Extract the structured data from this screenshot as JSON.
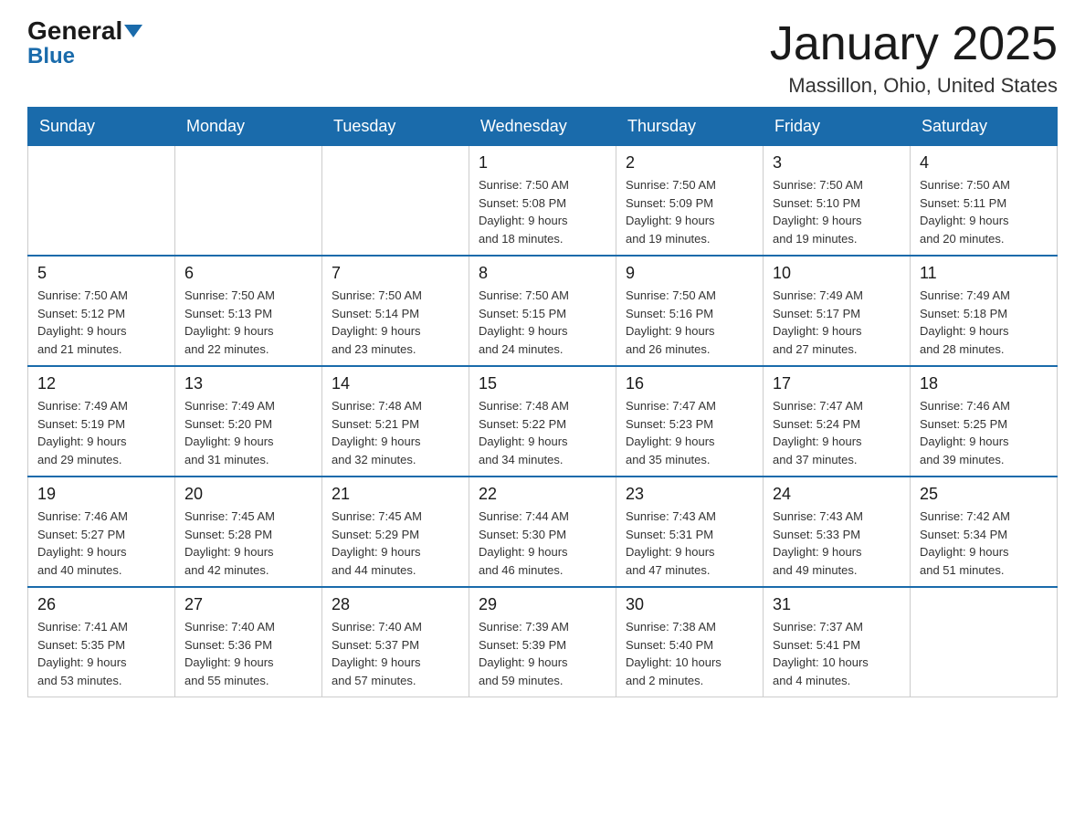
{
  "logo": {
    "general": "General",
    "blue": "Blue"
  },
  "header": {
    "title": "January 2025",
    "location": "Massillon, Ohio, United States"
  },
  "days_of_week": [
    "Sunday",
    "Monday",
    "Tuesday",
    "Wednesday",
    "Thursday",
    "Friday",
    "Saturday"
  ],
  "weeks": [
    [
      {
        "day": "",
        "info": ""
      },
      {
        "day": "",
        "info": ""
      },
      {
        "day": "",
        "info": ""
      },
      {
        "day": "1",
        "info": "Sunrise: 7:50 AM\nSunset: 5:08 PM\nDaylight: 9 hours\nand 18 minutes."
      },
      {
        "day": "2",
        "info": "Sunrise: 7:50 AM\nSunset: 5:09 PM\nDaylight: 9 hours\nand 19 minutes."
      },
      {
        "day": "3",
        "info": "Sunrise: 7:50 AM\nSunset: 5:10 PM\nDaylight: 9 hours\nand 19 minutes."
      },
      {
        "day": "4",
        "info": "Sunrise: 7:50 AM\nSunset: 5:11 PM\nDaylight: 9 hours\nand 20 minutes."
      }
    ],
    [
      {
        "day": "5",
        "info": "Sunrise: 7:50 AM\nSunset: 5:12 PM\nDaylight: 9 hours\nand 21 minutes."
      },
      {
        "day": "6",
        "info": "Sunrise: 7:50 AM\nSunset: 5:13 PM\nDaylight: 9 hours\nand 22 minutes."
      },
      {
        "day": "7",
        "info": "Sunrise: 7:50 AM\nSunset: 5:14 PM\nDaylight: 9 hours\nand 23 minutes."
      },
      {
        "day": "8",
        "info": "Sunrise: 7:50 AM\nSunset: 5:15 PM\nDaylight: 9 hours\nand 24 minutes."
      },
      {
        "day": "9",
        "info": "Sunrise: 7:50 AM\nSunset: 5:16 PM\nDaylight: 9 hours\nand 26 minutes."
      },
      {
        "day": "10",
        "info": "Sunrise: 7:49 AM\nSunset: 5:17 PM\nDaylight: 9 hours\nand 27 minutes."
      },
      {
        "day": "11",
        "info": "Sunrise: 7:49 AM\nSunset: 5:18 PM\nDaylight: 9 hours\nand 28 minutes."
      }
    ],
    [
      {
        "day": "12",
        "info": "Sunrise: 7:49 AM\nSunset: 5:19 PM\nDaylight: 9 hours\nand 29 minutes."
      },
      {
        "day": "13",
        "info": "Sunrise: 7:49 AM\nSunset: 5:20 PM\nDaylight: 9 hours\nand 31 minutes."
      },
      {
        "day": "14",
        "info": "Sunrise: 7:48 AM\nSunset: 5:21 PM\nDaylight: 9 hours\nand 32 minutes."
      },
      {
        "day": "15",
        "info": "Sunrise: 7:48 AM\nSunset: 5:22 PM\nDaylight: 9 hours\nand 34 minutes."
      },
      {
        "day": "16",
        "info": "Sunrise: 7:47 AM\nSunset: 5:23 PM\nDaylight: 9 hours\nand 35 minutes."
      },
      {
        "day": "17",
        "info": "Sunrise: 7:47 AM\nSunset: 5:24 PM\nDaylight: 9 hours\nand 37 minutes."
      },
      {
        "day": "18",
        "info": "Sunrise: 7:46 AM\nSunset: 5:25 PM\nDaylight: 9 hours\nand 39 minutes."
      }
    ],
    [
      {
        "day": "19",
        "info": "Sunrise: 7:46 AM\nSunset: 5:27 PM\nDaylight: 9 hours\nand 40 minutes."
      },
      {
        "day": "20",
        "info": "Sunrise: 7:45 AM\nSunset: 5:28 PM\nDaylight: 9 hours\nand 42 minutes."
      },
      {
        "day": "21",
        "info": "Sunrise: 7:45 AM\nSunset: 5:29 PM\nDaylight: 9 hours\nand 44 minutes."
      },
      {
        "day": "22",
        "info": "Sunrise: 7:44 AM\nSunset: 5:30 PM\nDaylight: 9 hours\nand 46 minutes."
      },
      {
        "day": "23",
        "info": "Sunrise: 7:43 AM\nSunset: 5:31 PM\nDaylight: 9 hours\nand 47 minutes."
      },
      {
        "day": "24",
        "info": "Sunrise: 7:43 AM\nSunset: 5:33 PM\nDaylight: 9 hours\nand 49 minutes."
      },
      {
        "day": "25",
        "info": "Sunrise: 7:42 AM\nSunset: 5:34 PM\nDaylight: 9 hours\nand 51 minutes."
      }
    ],
    [
      {
        "day": "26",
        "info": "Sunrise: 7:41 AM\nSunset: 5:35 PM\nDaylight: 9 hours\nand 53 minutes."
      },
      {
        "day": "27",
        "info": "Sunrise: 7:40 AM\nSunset: 5:36 PM\nDaylight: 9 hours\nand 55 minutes."
      },
      {
        "day": "28",
        "info": "Sunrise: 7:40 AM\nSunset: 5:37 PM\nDaylight: 9 hours\nand 57 minutes."
      },
      {
        "day": "29",
        "info": "Sunrise: 7:39 AM\nSunset: 5:39 PM\nDaylight: 9 hours\nand 59 minutes."
      },
      {
        "day": "30",
        "info": "Sunrise: 7:38 AM\nSunset: 5:40 PM\nDaylight: 10 hours\nand 2 minutes."
      },
      {
        "day": "31",
        "info": "Sunrise: 7:37 AM\nSunset: 5:41 PM\nDaylight: 10 hours\nand 4 minutes."
      },
      {
        "day": "",
        "info": ""
      }
    ]
  ]
}
